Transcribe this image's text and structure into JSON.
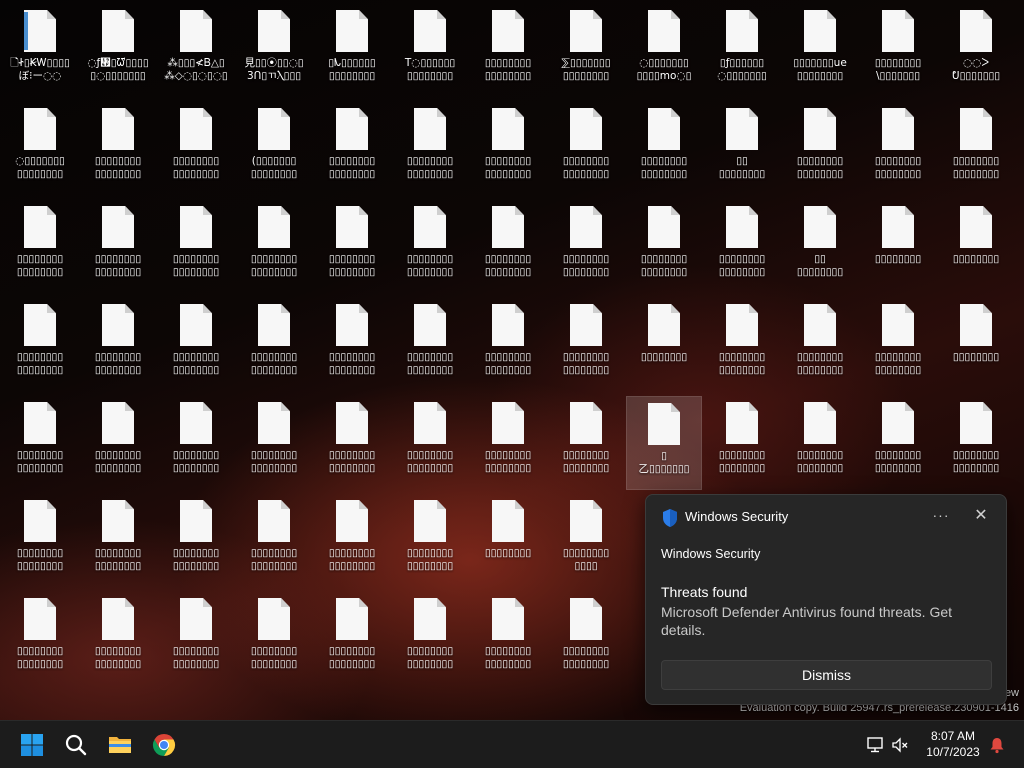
{
  "desktop": {
    "rows": [
      [
        {
          "label": "🗋Ꮠ▯ꞢᎳ▯▯▯▯\nぼ⁝ー◌◌",
          "thumb": true
        },
        {
          "label": "◌ƒ᥯▯ᘺ▯▯▯▯\n▯◌▯▯▯▯▯▯▯",
          "thumb": false
        },
        {
          "label": "⁂▯▯▯≮Ᏼ△▯\n⁂◇◌▯◌▯◌▯",
          "thumb": false
        },
        {
          "label": "見▯▯⦿▯▯◌▯\n3ᑎ▯ㄲⲖ▯▯▯",
          "thumb": false
        },
        {
          "label": "▯ᗃ▯▯▯▯▯▯\n▯▯▯▯▯▯▯▯",
          "thumb": false
        },
        {
          "label": "T◌▯▯▯▯▯▯\n▯▯▯▯▯▯▯▯",
          "thumb": false
        },
        {
          "label": "▯▯▯▯▯▯▯▯\n▯▯▯▯▯▯▯▯",
          "thumb": false
        },
        {
          "label": "⅀▯▯▯▯▯▯▯\n▯▯▯▯▯▯▯▯",
          "thumb": false
        },
        {
          "label": "◌▯▯▯▯▯▯▯\n▯▯▯▯mo◌▯",
          "thumb": false
        },
        {
          "label": "▯ƒ▯▯▯▯▯▯\n◌▯▯▯▯▯▯▯",
          "thumb": false
        },
        {
          "label": "▯▯▯▯▯▯▯ue\n▯▯▯▯▯▯▯▯",
          "thumb": false
        },
        {
          "label": "▯▯▯▯▯▯▯▯\n\\▯▯▯▯▯▯▯",
          "thumb": false
        },
        {
          "label": "◌◌ᐳ\nᕞ▯▯▯▯▯▯▯",
          "thumb": false
        }
      ],
      [
        {
          "label": "◌▯▯▯▯▯▯▯\n▯▯▯▯▯▯▯▯",
          "thumb": false
        },
        {
          "label": "▯▯▯▯▯▯▯▯\n▯▯▯▯▯▯▯▯",
          "thumb": false
        },
        {
          "label": "▯▯▯▯▯▯▯▯\n▯▯▯▯▯▯▯▯",
          "thumb": false
        },
        {
          "label": "(▯▯▯▯▯▯▯\n▯▯▯▯▯▯▯▯",
          "thumb": false
        },
        {
          "label": "▯▯▯▯▯▯▯▯\n▯▯▯▯▯▯▯▯",
          "thumb": false
        },
        {
          "label": "▯▯▯▯▯▯▯▯\n▯▯▯▯▯▯▯▯",
          "thumb": false
        },
        {
          "label": "▯▯▯▯▯▯▯▯\n▯▯▯▯▯▯▯▯",
          "thumb": false
        },
        {
          "label": "▯▯▯▯▯▯▯▯\n▯▯▯▯▯▯▯▯",
          "thumb": false
        },
        {
          "label": "▯▯▯▯▯▯▯▯\n▯▯▯▯▯▯▯▯",
          "thumb": false
        },
        {
          "label": "▯▯\n▯▯▯▯▯▯▯▯",
          "thumb": false
        },
        {
          "label": "▯▯▯▯▯▯▯▯\n▯▯▯▯▯▯▯▯",
          "thumb": false
        },
        {
          "label": "▯▯▯▯▯▯▯▯\n▯▯▯▯▯▯▯▯",
          "thumb": false
        },
        {
          "label": "▯▯▯▯▯▯▯▯\n▯▯▯▯▯▯▯▯",
          "thumb": false
        }
      ],
      [
        {
          "label": "▯▯▯▯▯▯▯▯\n▯▯▯▯▯▯▯▯",
          "thumb": false
        },
        {
          "label": "▯▯▯▯▯▯▯▯\n▯▯▯▯▯▯▯▯",
          "thumb": false
        },
        {
          "label": "▯▯▯▯▯▯▯▯\n▯▯▯▯▯▯▯▯",
          "thumb": false
        },
        {
          "label": "▯▯▯▯▯▯▯▯\n▯▯▯▯▯▯▯▯",
          "thumb": false
        },
        {
          "label": "▯▯▯▯▯▯▯▯\n▯▯▯▯▯▯▯▯",
          "thumb": false
        },
        {
          "label": "▯▯▯▯▯▯▯▯\n▯▯▯▯▯▯▯▯",
          "thumb": false
        },
        {
          "label": "▯▯▯▯▯▯▯▯\n▯▯▯▯▯▯▯▯",
          "thumb": false
        },
        {
          "label": "▯▯▯▯▯▯▯▯\n▯▯▯▯▯▯▯▯",
          "thumb": false
        },
        {
          "label": "▯▯▯▯▯▯▯▯\n▯▯▯▯▯▯▯▯",
          "thumb": false
        },
        {
          "label": "▯▯▯▯▯▯▯▯\n▯▯▯▯▯▯▯▯",
          "thumb": false
        },
        {
          "label": "▯▯\n▯▯▯▯▯▯▯▯",
          "thumb": false
        },
        {
          "label": "▯▯▯▯▯▯▯▯\n",
          "thumb": false
        },
        {
          "label": "▯▯▯▯▯▯▯▯\n",
          "thumb": false
        }
      ],
      [
        {
          "label": "▯▯▯▯▯▯▯▯\n▯▯▯▯▯▯▯▯",
          "thumb": false
        },
        {
          "label": "▯▯▯▯▯▯▯▯\n▯▯▯▯▯▯▯▯",
          "thumb": false
        },
        {
          "label": "▯▯▯▯▯▯▯▯\n▯▯▯▯▯▯▯▯",
          "thumb": false
        },
        {
          "label": "▯▯▯▯▯▯▯▯\n▯▯▯▯▯▯▯▯",
          "thumb": false
        },
        {
          "label": "▯▯▯▯▯▯▯▯\n▯▯▯▯▯▯▯▯",
          "thumb": false
        },
        {
          "label": "▯▯▯▯▯▯▯▯\n▯▯▯▯▯▯▯▯",
          "thumb": false
        },
        {
          "label": "▯▯▯▯▯▯▯▯\n▯▯▯▯▯▯▯▯",
          "thumb": false
        },
        {
          "label": "▯▯▯▯▯▯▯▯\n▯▯▯▯▯▯▯▯",
          "thumb": false
        },
        {
          "label": "▯▯▯▯▯▯▯▯\n",
          "thumb": false
        },
        {
          "label": "▯▯▯▯▯▯▯▯\n▯▯▯▯▯▯▯▯",
          "thumb": false
        },
        {
          "label": "▯▯▯▯▯▯▯▯\n▯▯▯▯▯▯▯▯",
          "thumb": false
        },
        {
          "label": "▯▯▯▯▯▯▯▯\n▯▯▯▯▯▯▯▯",
          "thumb": false
        },
        {
          "label": "▯▯▯▯▯▯▯▯\n",
          "thumb": false
        }
      ],
      [
        {
          "label": "▯▯▯▯▯▯▯▯\n▯▯▯▯▯▯▯▯",
          "thumb": false
        },
        {
          "label": "▯▯▯▯▯▯▯▯\n▯▯▯▯▯▯▯▯",
          "thumb": false
        },
        {
          "label": "▯▯▯▯▯▯▯▯\n▯▯▯▯▯▯▯▯",
          "thumb": false
        },
        {
          "label": "▯▯▯▯▯▯▯▯\n▯▯▯▯▯▯▯▯",
          "thumb": false
        },
        {
          "label": "▯▯▯▯▯▯▯▯\n▯▯▯▯▯▯▯▯",
          "thumb": false
        },
        {
          "label": "▯▯▯▯▯▯▯▯\n▯▯▯▯▯▯▯▯",
          "thumb": false
        },
        {
          "label": "▯▯▯▯▯▯▯▯\n▯▯▯▯▯▯▯▯",
          "thumb": false
        },
        {
          "label": "▯▯▯▯▯▯▯▯\n▯▯▯▯▯▯▯▯",
          "thumb": false
        },
        {
          "label": "▯\n乙▯▯▯▯▯▯▯",
          "thumb": false,
          "selected": true
        },
        {
          "label": "▯▯▯▯▯▯▯▯\n▯▯▯▯▯▯▯▯",
          "thumb": false
        },
        {
          "label": "▯▯▯▯▯▯▯▯\n▯▯▯▯▯▯▯▯",
          "thumb": false
        },
        {
          "label": "▯▯▯▯▯▯▯▯\n▯▯▯▯▯▯▯▯",
          "thumb": false
        },
        {
          "label": "▯▯▯▯▯▯▯▯\n▯▯▯▯▯▯▯▯",
          "thumb": false
        }
      ],
      [
        {
          "label": "▯▯▯▯▯▯▯▯\n▯▯▯▯▯▯▯▯",
          "thumb": false
        },
        {
          "label": "▯▯▯▯▯▯▯▯\n▯▯▯▯▯▯▯▯",
          "thumb": false
        },
        {
          "label": "▯▯▯▯▯▯▯▯\n▯▯▯▯▯▯▯▯",
          "thumb": false
        },
        {
          "label": "▯▯▯▯▯▯▯▯\n▯▯▯▯▯▯▯▯",
          "thumb": false
        },
        {
          "label": "▯▯▯▯▯▯▯▯\n▯▯▯▯▯▯▯▯",
          "thumb": false
        },
        {
          "label": "▯▯▯▯▯▯▯▯\n▯▯▯▯▯▯▯▯",
          "thumb": false
        },
        {
          "label": "▯▯▯▯▯▯▯▯\n",
          "thumb": false
        },
        {
          "label": "▯▯▯▯▯▯▯▯\n▯▯▯▯",
          "thumb": false
        }
      ],
      [
        {
          "label": "▯▯▯▯▯▯▯▯\n▯▯▯▯▯▯▯▯",
          "thumb": false
        },
        {
          "label": "▯▯▯▯▯▯▯▯\n▯▯▯▯▯▯▯▯",
          "thumb": false
        },
        {
          "label": "▯▯▯▯▯▯▯▯\n▯▯▯▯▯▯▯▯",
          "thumb": false
        },
        {
          "label": "▯▯▯▯▯▯▯▯\n▯▯▯▯▯▯▯▯",
          "thumb": false
        },
        {
          "label": "▯▯▯▯▯▯▯▯\n▯▯▯▯▯▯▯▯",
          "thumb": false
        },
        {
          "label": "▯▯▯▯▯▯▯▯\n▯▯▯▯▯▯▯▯",
          "thumb": false
        },
        {
          "label": "▯▯▯▯▯▯▯▯\n▯▯▯▯▯▯▯▯",
          "thumb": false
        },
        {
          "label": "▯▯▯▯▯▯▯▯\n▯▯▯▯▯▯▯▯",
          "thumb": false
        }
      ]
    ]
  },
  "watermark": {
    "line1": "ew",
    "line2": "Evaluation copy. Build 25947.rs_prerelease.230901-1416"
  },
  "toast": {
    "app_name": "Windows Security",
    "more_label": "···",
    "close_label": "✕",
    "heading": "Windows Security",
    "title": "Threats found",
    "body": "Microsoft Defender Antivirus found threats. Get details.",
    "dismiss_label": "Dismiss",
    "accent": "#2b7de9"
  },
  "taskbar": {
    "apps": [
      {
        "name": "start-button",
        "icon": "windows-logo-icon"
      },
      {
        "name": "search-button",
        "icon": "search-icon"
      },
      {
        "name": "file-explorer-button",
        "icon": "folder-icon"
      },
      {
        "name": "chrome-button",
        "icon": "chrome-icon"
      }
    ],
    "tray": {
      "network_icon": "network-icon",
      "volume_icon": "volume-muted-icon",
      "notification_icon": "bell-icon"
    },
    "clock": {
      "time": "8:07 AM",
      "date": "10/7/2023"
    },
    "notification_color": "#e0483f"
  }
}
